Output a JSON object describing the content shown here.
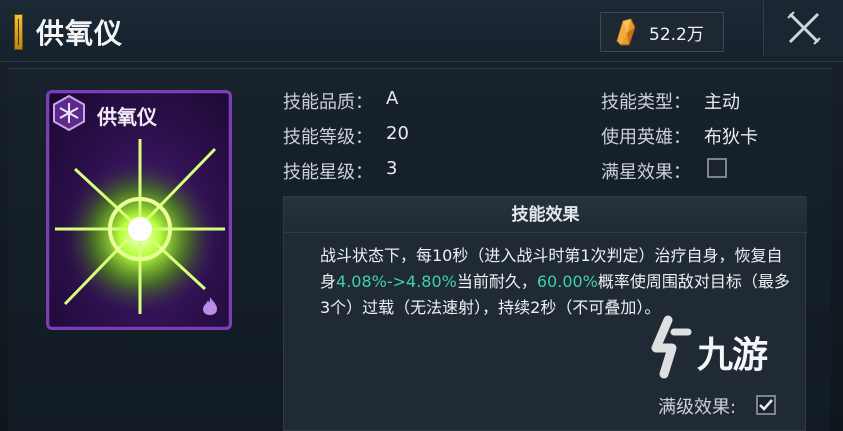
{
  "header": {
    "title": "供氧仪",
    "currency_value": "52.2万"
  },
  "card": {
    "name": "供氧仪"
  },
  "attributes": {
    "quality_label": "技能品质：",
    "quality_value": "A",
    "level_label": "技能等级：",
    "level_value": "20",
    "star_label": "技能星级：",
    "star_value": "3",
    "type_label": "技能类型：",
    "type_value": "主动",
    "hero_label": "使用英雄：",
    "hero_value": "布狄卡",
    "fullstar_label": "满星效果：",
    "fullstar_checked": false
  },
  "effect": {
    "title": "技能效果",
    "text_1": "战斗状态下，每10秒（进入战斗时第1次判定）治疗自身，恢复自身",
    "highlight_1": "4.08%->4.80%",
    "text_2": "当前耐久，",
    "highlight_2": "60.00%",
    "text_3": "概率使周围敌对目标（最多3个）过载（无法速射），持续2秒（不可叠加）。"
  },
  "max_level": {
    "label": "满级效果:",
    "checked": true
  },
  "watermark": {
    "text": "九游"
  },
  "colors": {
    "highlight": "#3fd0a8",
    "card_border": "#7b3fb5",
    "title_accent": "#f2c23a"
  }
}
